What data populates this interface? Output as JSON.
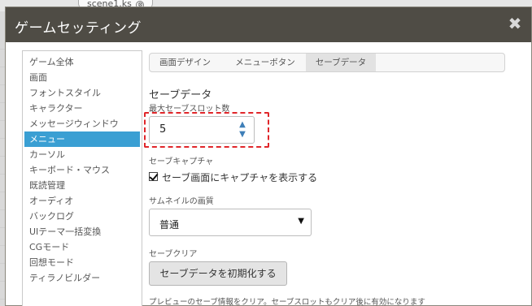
{
  "background": {
    "tab_label": "scene1.ks",
    "tab_close": "⊗"
  },
  "dialog": {
    "title": "ゲームセッティング",
    "close_glyph": "✖"
  },
  "sidebar": {
    "items": [
      {
        "label": "ゲーム全体",
        "active": false
      },
      {
        "label": "画面",
        "active": false
      },
      {
        "label": "フォントスタイル",
        "active": false
      },
      {
        "label": "キャラクター",
        "active": false
      },
      {
        "label": "メッセージウィンドウ",
        "active": false
      },
      {
        "label": "メニュー",
        "active": true
      },
      {
        "label": "カーソル",
        "active": false
      },
      {
        "label": "キーボード・マウス",
        "active": false
      },
      {
        "label": "既読管理",
        "active": false
      },
      {
        "label": "オーディオ",
        "active": false
      },
      {
        "label": "バックログ",
        "active": false
      },
      {
        "label": "UIテーマ一括変換",
        "active": false
      },
      {
        "label": "CGモード",
        "active": false
      },
      {
        "label": "回想モード",
        "active": false
      },
      {
        "label": "ティラノビルダー",
        "active": false
      }
    ]
  },
  "tabs": [
    {
      "label": "画面デザイン",
      "active": false
    },
    {
      "label": "メニューボタン",
      "active": false
    },
    {
      "label": "セーブデータ",
      "active": true
    }
  ],
  "save": {
    "heading": "セーブデータ",
    "max_slots_label": "最大セーブスロット数",
    "max_slots_value": "5",
    "spin_up": "▲",
    "spin_down": "▼",
    "capture_heading": "セーブキャプチャ",
    "capture_checkbox_label": "セーブ画面にキャプチャを表示する",
    "capture_checked": true,
    "thumb_quality_label": "サムネイルの画質",
    "thumb_quality_value": "普通",
    "select_arrow": "▼",
    "clear_heading": "セーブクリア",
    "clear_button_label": "セーブデータを初期化する",
    "clear_help": "プレビューのセーブ情報をクリア。セーブスロットもクリア後に有効になります"
  },
  "colors": {
    "titlebar": "#4f4c45",
    "active_item": "#3a9fd3",
    "highlight": "#e0262a",
    "spin": "#3e7fb8"
  }
}
